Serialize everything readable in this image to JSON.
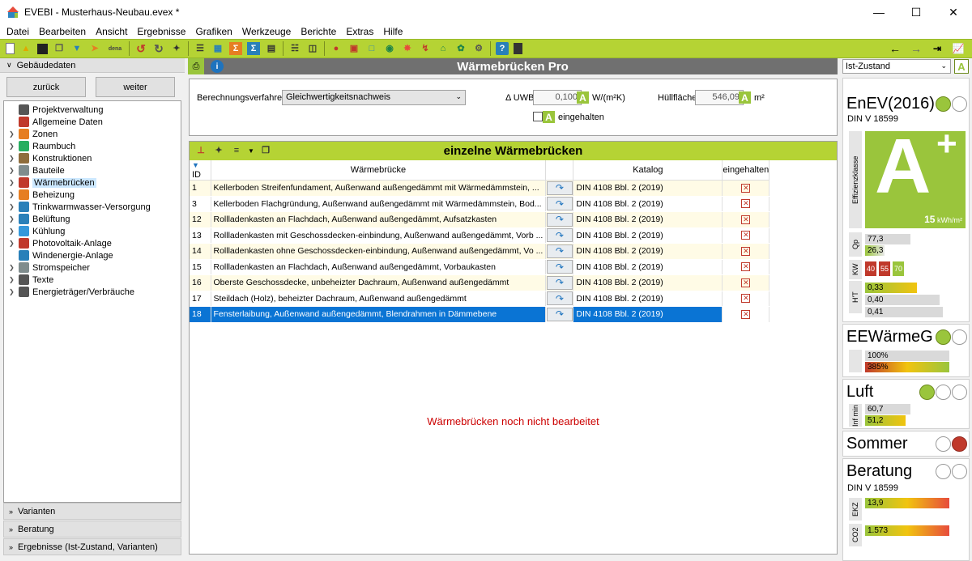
{
  "window": {
    "title": "EVEBI - Musterhaus-Neubau.evex *"
  },
  "menu": [
    "Datei",
    "Bearbeiten",
    "Ansicht",
    "Ergebnisse",
    "Grafiken",
    "Werkzeuge",
    "Berichte",
    "Extras",
    "Hilfe"
  ],
  "toolbar": {
    "dena_label": "dena"
  },
  "left": {
    "header": "Gebäudedaten",
    "back_label": "zurück",
    "next_label": "weiter",
    "tree": [
      {
        "label": "Projektverwaltung",
        "icon": "clock-icon",
        "color": "#555",
        "arrow": false
      },
      {
        "label": "Allgemeine Daten",
        "icon": "house-icon",
        "color": "#c0392b",
        "arrow": false
      },
      {
        "label": "Zonen",
        "icon": "zones-icon",
        "color": "#e67e22",
        "arrow": true
      },
      {
        "label": "Raumbuch",
        "icon": "room-icon",
        "color": "#27ae60",
        "arrow": true
      },
      {
        "label": "Konstruktionen",
        "icon": "construction-icon",
        "color": "#8e6d3c",
        "arrow": true
      },
      {
        "label": "Bauteile",
        "icon": "component-icon",
        "color": "#7f8c8d",
        "arrow": true
      },
      {
        "label": "Wärmebrücken",
        "icon": "thermal-bridge-icon",
        "color": "#c0392b",
        "arrow": true,
        "selected": true
      },
      {
        "label": "Beheizung",
        "icon": "heating-icon",
        "color": "#e67e22",
        "arrow": true
      },
      {
        "label": "Trinkwarmwasser-Versorgung",
        "icon": "water-drop-icon",
        "color": "#2980b9",
        "arrow": true
      },
      {
        "label": "Belüftung",
        "icon": "fan-icon",
        "color": "#2980b9",
        "arrow": true
      },
      {
        "label": "Kühlung",
        "icon": "snowflake-icon",
        "color": "#3498db",
        "arrow": true
      },
      {
        "label": "Photovoltaik-Anlage",
        "icon": "solar-icon",
        "color": "#c0392b",
        "arrow": true
      },
      {
        "label": "Windenergie-Anlage",
        "icon": "wind-icon",
        "color": "#2980b9",
        "arrow": false
      },
      {
        "label": "Stromspeicher",
        "icon": "battery-icon",
        "color": "#7f8c8d",
        "arrow": true
      },
      {
        "label": "Texte",
        "icon": "text-icon",
        "color": "#555",
        "arrow": true
      },
      {
        "label": "Energieträger/Verbräuche",
        "icon": "plug-icon",
        "color": "#555",
        "arrow": true
      }
    ],
    "sections": [
      "Varianten",
      "Beratung",
      "Ergebnisse (Ist-Zustand, Varianten)"
    ]
  },
  "main": {
    "title": "Wärmebrücken Pro",
    "method_label": "Berechnungsverfahren",
    "method_value": "Gleichwertigkeitsnachweis",
    "uwb_label": "Δ UWB",
    "uwb_value": "0,100",
    "uwb_unit": "W/(m²K)",
    "area_label": "Hüllfläche",
    "area_value": "546,09",
    "area_unit": "m²",
    "badge": "A",
    "ok_label": "eingehalten",
    "grid_title": "einzelne Wärmebrücken",
    "columns": {
      "id": "ID",
      "name": "Wärmebrücke",
      "catalog": "Katalog",
      "ok": "eingehalten"
    },
    "rows": [
      {
        "id": "1",
        "name": "Kellerboden Streifenfundament, Außenwand außengedämmt mit Wärmedämmstein, ...",
        "catalog": "DIN 4108 Bbl. 2 (2019)"
      },
      {
        "id": "3",
        "name": "Kellerboden Flachgründung, Außenwand außengedämmt mit Wärmedämmstein, Bod...",
        "catalog": "DIN 4108 Bbl. 2 (2019)"
      },
      {
        "id": "12",
        "name": "Rollladenkasten an Flachdach, Außenwand außengedämmt, Aufsatzkasten",
        "catalog": "DIN 4108 Bbl. 2 (2019)"
      },
      {
        "id": "13",
        "name": "Rollladenkasten mit Geschossdecken-einbindung, Außenwand außengedämmt, Vorb ...",
        "catalog": "DIN 4108 Bbl. 2 (2019)"
      },
      {
        "id": "14",
        "name": "Rollladenkasten ohne Geschossdecken-einbindung, Außenwand außengedämmt, Vo ...",
        "catalog": "DIN 4108 Bbl. 2 (2019)"
      },
      {
        "id": "15",
        "name": "Rollladenkasten an Flachdach, Außenwand außengedämmt, Vorbaukasten",
        "catalog": "DIN 4108 Bbl. 2 (2019)"
      },
      {
        "id": "16",
        "name": "Oberste Geschossdecke, unbeheizter Dachraum, Außenwand außengedämmt",
        "catalog": "DIN 4108 Bbl. 2 (2019)"
      },
      {
        "id": "17",
        "name": "Steildach (Holz), beheizter Dachraum, Außenwand außengedämmt",
        "catalog": "DIN 4108 Bbl. 2 (2019)"
      },
      {
        "id": "18",
        "name": "Fensterlaibung, Außenwand außengedämmt, Blendrahmen in Dämmebene",
        "catalog": "DIN 4108 Bbl. 2 (2019)"
      }
    ],
    "warning": "Wärmebrücken noch nicht bearbeitet"
  },
  "right": {
    "state": "Ist-Zustand",
    "state_badge": "A",
    "enev": {
      "title": "EnEV(2016)",
      "sub": "DIN V 18599",
      "effclass_label": "Effizienzklasse",
      "big_letter": "A",
      "plus": "+",
      "kwh_value": "15",
      "kwh_unit": "kWh/m²",
      "qp_label": "Qp",
      "qp": [
        "77,3",
        "26,3"
      ],
      "kw_label": "KW",
      "kw": [
        "40",
        "55",
        "70"
      ],
      "ht_label": "H'T",
      "ht": [
        "0,33",
        "0,40",
        "0,41"
      ]
    },
    "ee": {
      "title": "EEWärmeG",
      "vals": [
        "100%",
        "385%"
      ]
    },
    "luft": {
      "title": "Luft",
      "label": "Inf min",
      "vals": [
        "60,7",
        "51,2"
      ]
    },
    "sommer": {
      "title": "Sommer"
    },
    "beratung": {
      "title": "Beratung",
      "sub": "DIN V 18599",
      "ekz_label": "EKZ",
      "ekz": "13,9",
      "co2_label": "CO2",
      "co2": "1.573"
    }
  },
  "colors": {
    "accent": "#9ac53c",
    "toolbar": "#b5d334",
    "selection": "#0a74d4",
    "warning": "#cc0000"
  }
}
